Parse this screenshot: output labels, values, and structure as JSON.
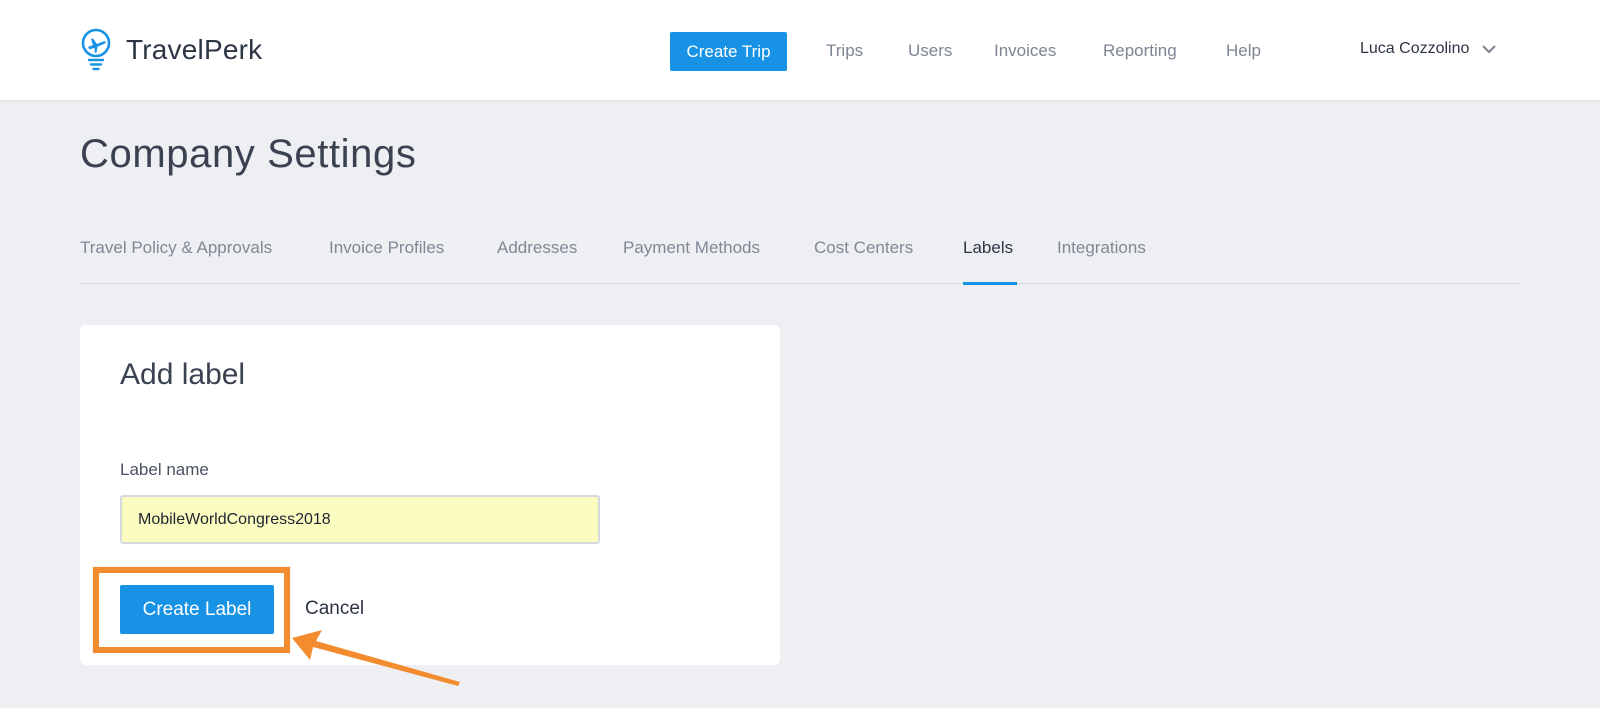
{
  "brand": {
    "name": "TravelPerk",
    "accent": "#1792e5",
    "highlight": "#f28c2e"
  },
  "header": {
    "create_trip_label": "Create Trip",
    "nav": [
      "Trips",
      "Users",
      "Invoices",
      "Reporting",
      "Help"
    ],
    "user_name": "Luca Cozzolino"
  },
  "page": {
    "title": "Company Settings"
  },
  "tabs": [
    {
      "label": "Travel Policy & Approvals",
      "active": false
    },
    {
      "label": "Invoice Profiles",
      "active": false
    },
    {
      "label": "Addresses",
      "active": false
    },
    {
      "label": "Payment Methods",
      "active": false
    },
    {
      "label": "Cost Centers",
      "active": false
    },
    {
      "label": "Labels",
      "active": true
    },
    {
      "label": "Integrations",
      "active": false
    }
  ],
  "form": {
    "title": "Add label",
    "field_label": "Label name",
    "field_value": "MobileWorldCongress2018",
    "submit_label": "Create Label",
    "cancel_label": "Cancel"
  },
  "icons": {
    "logo": "airplane-globe-icon",
    "user_menu": "chevron-down-icon",
    "annotation": "arrow-icon"
  }
}
